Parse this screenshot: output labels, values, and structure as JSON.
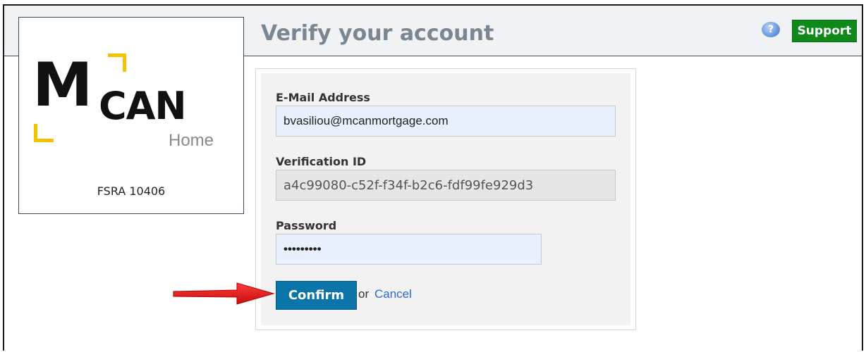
{
  "header": {
    "title": "Verify your account",
    "help_icon_glyph": "?",
    "support_label": "Support"
  },
  "logo": {
    "m": "M",
    "can": "CAN",
    "home": "Home",
    "registration": "FSRA 10406",
    "accent_color": "#f5c200"
  },
  "form": {
    "email": {
      "label": "E-Mail Address",
      "value": "bvasiliou@mcanmortgage.com"
    },
    "verification": {
      "label": "Verification ID",
      "value": "a4c99080-c52f-f34f-b2c6-fdf99fe929d3"
    },
    "password": {
      "label": "Password",
      "value": "•••••••••"
    },
    "confirm_label": "Confirm",
    "or_text": "or",
    "cancel_label": "Cancel"
  },
  "colors": {
    "support_green": "#0f8a1a",
    "confirm_blue": "#0b74a8",
    "annotation_arrow": "#e01b1b"
  }
}
